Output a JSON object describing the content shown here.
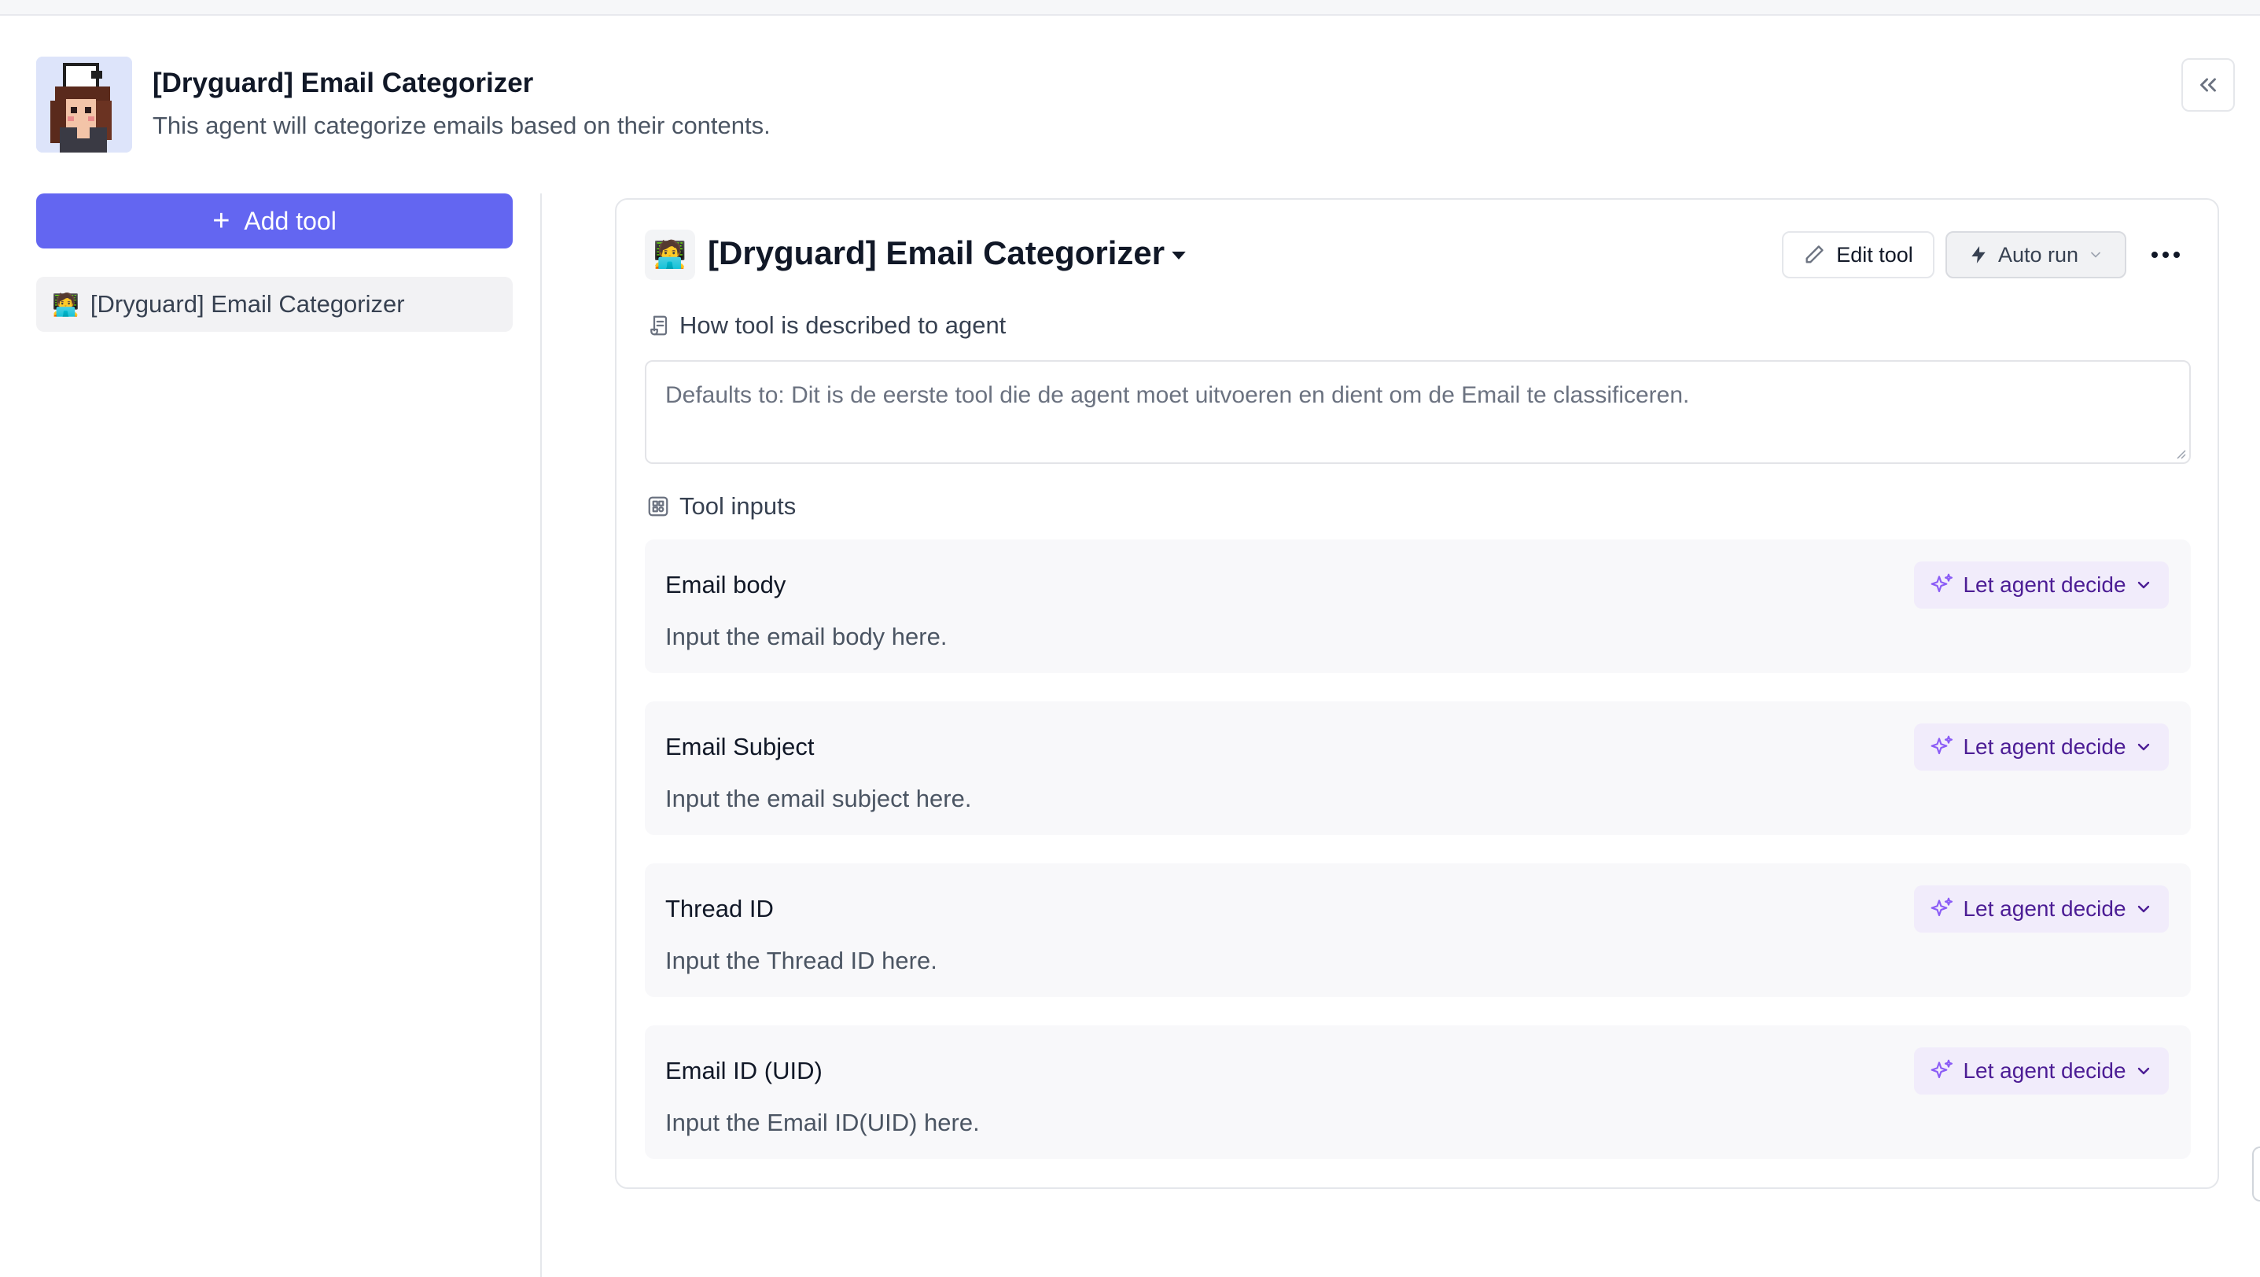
{
  "agent": {
    "title": "[Dryguard] Email Categorizer",
    "description": "This agent will categorize emails based on their contents."
  },
  "sidebar": {
    "add_tool_label": "Add tool",
    "items": [
      {
        "emoji": "🧑‍💻",
        "label": "[Dryguard] Email Categorizer"
      }
    ]
  },
  "tool": {
    "emoji": "🧑‍💻",
    "title": "[Dryguard] Email Categorizer",
    "edit_label": "Edit tool",
    "autorun_label": "Auto run",
    "description_section_label": "How tool is described to agent",
    "description_placeholder": "Defaults to: Dit is de eerste tool die de agent moet uitvoeren en dient om de Email te classificeren.",
    "inputs_section_label": "Tool inputs",
    "inputs": [
      {
        "name": "Email body",
        "placeholder": "Input the email body here.",
        "mode": "Let agent decide"
      },
      {
        "name": "Email Subject",
        "placeholder": "Input the email subject here.",
        "mode": "Let agent decide"
      },
      {
        "name": "Thread ID",
        "placeholder": "Input the Thread ID here.",
        "mode": "Let agent decide"
      },
      {
        "name": "Email ID (UID)",
        "placeholder": "Input the Email ID(UID) here.",
        "mode": "Let agent decide"
      }
    ]
  },
  "colors": {
    "primary": "#6366f1",
    "decide_bg": "#f1ecfb",
    "decide_text": "#4c1d95"
  }
}
